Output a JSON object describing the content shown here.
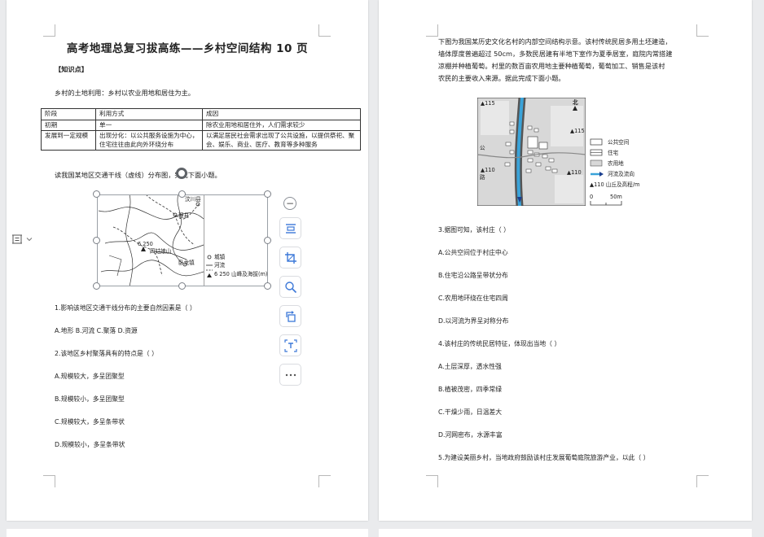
{
  "left_page": {
    "title": "高考地理总复习拔高练——乡村空间结构 10 页",
    "section_label": "【知识点】",
    "intro": "乡村的土地利用：乡村以农业用地和居住为主。",
    "table": {
      "headers": [
        "阶段",
        "利用方式",
        "成因"
      ],
      "rows": [
        [
          "初期",
          "单一",
          "除农业用地和居住外，人们需求较少"
        ],
        [
          "发展到一定规模",
          "出现分化：以公共服务设施为中心，住宅往往由此向外环绕分布",
          "以满足居民社会需求出现了公共设施，以提供祭祀、聚会、娱乐、商业、医疗、教育等多种服务"
        ]
      ]
    },
    "map_intro": "读我国某地区交通干线（虚线）分布图，完成下面小题。",
    "map_labels": {
      "county1": "汶川县",
      "county2": "理县",
      "mountain": "四姑娘山",
      "elev": "6 250",
      "town": "卧龙镇",
      "legend_city": "城镇",
      "legend_river": "河流",
      "legend_peak": "6 250 山峰及海拔(m)"
    },
    "questions": [
      "1.影响该地区交通干线分布的主要自然因素是（ ）",
      "A.地形  B.河流  C.聚落  D.资源",
      "2.该地区乡村聚落具有的特点是（ ）",
      "A.规模较大，多呈团聚型",
      "B.规模较小，多呈团聚型",
      "C.规模较大，多呈条带状",
      "D.规模较小，多呈条带状"
    ]
  },
  "toolbar": {
    "buttons": [
      "collapse",
      "wrap-text",
      "crop",
      "zoom",
      "rotate",
      "ocr-text",
      "more"
    ]
  },
  "right_page": {
    "intro_lines": [
      "下图为我国某历史文化名村的内部空间结构示意。该村传统民居多用土坯建造，",
      "墙体厚度普遍超过 50cm，多数民居建有半地下室作为夏季居室，庭院内常搭建",
      "凉棚并种植葡萄。村里的数百亩农用地主要种植葡萄，葡萄加工、销售是该村",
      "农民的主要收入来源。据此完成下面小题。"
    ],
    "map": {
      "north": "北",
      "elev_115_a": "▲115",
      "elev_115_b": "▲115",
      "elev_110_a": "▲110",
      "elev_110_b": "▲110",
      "road_chars": [
        "公",
        "路"
      ],
      "scale_zero": "0",
      "scale_len": "50m",
      "legend": [
        "公共空间",
        "住宅",
        "农用地",
        "河流及流向",
        "▲110 山丘及高程/m"
      ]
    },
    "questions": [
      "3.据图可知，该村庄（ ）",
      "A.公共空间位于村庄中心",
      "B.住宅沿公路呈带状分布",
      "C.农用地环绕在住宅四周",
      "D.以河流为界呈对称分布",
      "4.该村庄的传统民居特征，体现出当地（ ）",
      "A.土层深厚，透水性强",
      "B.植被茂密，四季常绿",
      "C.干燥少雨，日温差大",
      "D.河网密布，水源丰富",
      "5.为建设美丽乡村，当地政府鼓励该村庄发展葡萄庭院旅游产业，以此（ ）"
    ]
  }
}
